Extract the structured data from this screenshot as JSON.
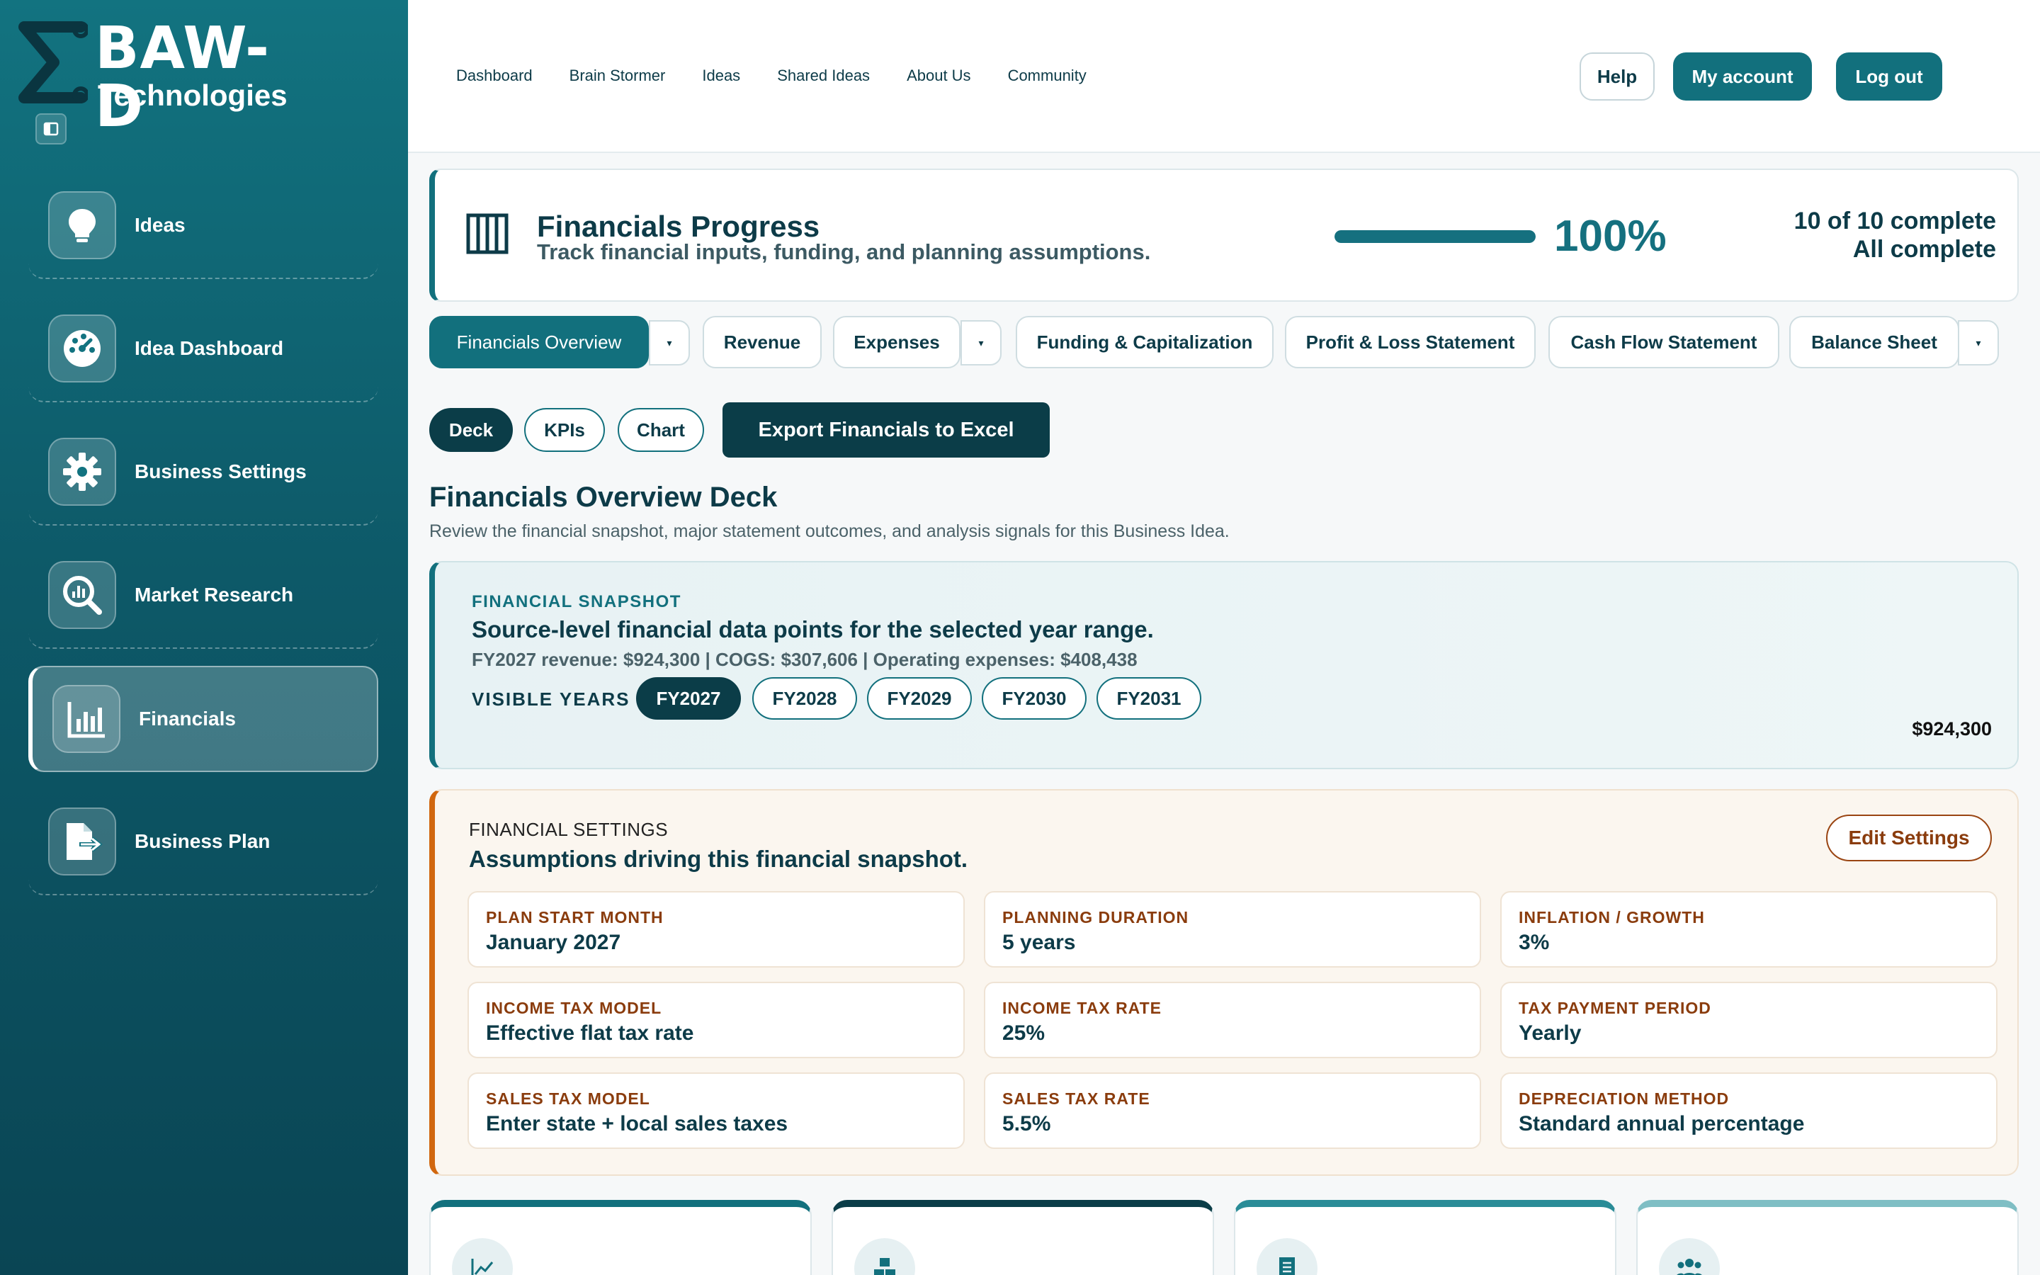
{
  "brand": {
    "name": "BAW-D",
    "sub": "Technologies"
  },
  "sidebar": {
    "items": [
      {
        "label": "Ideas",
        "icon": "lightbulb-icon"
      },
      {
        "label": "Idea Dashboard",
        "icon": "gauge-icon"
      },
      {
        "label": "Business Settings",
        "icon": "gear-icon"
      },
      {
        "label": "Market Research",
        "icon": "magnifier-chart-icon"
      },
      {
        "label": "Financials",
        "icon": "bar-chart-icon",
        "active": true
      },
      {
        "label": "Business Plan",
        "icon": "document-export-icon"
      }
    ]
  },
  "topnav": {
    "links": [
      "Dashboard",
      "Brain Stormer",
      "Ideas",
      "Shared Ideas",
      "About Us",
      "Community"
    ],
    "help": "Help",
    "account": "My account",
    "logout": "Log out"
  },
  "progress": {
    "title": "Financials Progress",
    "subtitle": "Track financial inputs, funding, and planning assumptions.",
    "percent": 100,
    "percent_label": "100%",
    "count": "10 of 10 complete",
    "status": "All complete"
  },
  "tabs": [
    "Financials Overview",
    "Revenue",
    "Expenses",
    "Funding & Capitalization",
    "Profit & Loss Statement",
    "Cash Flow Statement",
    "Balance Sheet"
  ],
  "subtabs": {
    "deck": "Deck",
    "kpis": "KPIs",
    "chart": "Chart",
    "export": "Export Financials to Excel"
  },
  "deck": {
    "title": "Financials Overview Deck",
    "subtitle": "Review the financial snapshot, major statement outcomes, and analysis signals for this Business Idea."
  },
  "snapshot": {
    "kicker": "FINANCIAL SNAPSHOT",
    "title": "Source-level financial data points for the selected year range.",
    "line": "FY2027 revenue: $924,300 | COGS: $307,606 | Operating expenses: $408,438",
    "visible_years_label": "VISIBLE YEARS",
    "years": [
      "FY2027",
      "FY2028",
      "FY2029",
      "FY2030",
      "FY2031"
    ],
    "selected_year": "FY2027",
    "value": "$924,300"
  },
  "settings": {
    "kicker": "FINANCIAL SETTINGS",
    "title": "Assumptions driving this financial snapshot.",
    "edit": "Edit Settings",
    "items": [
      {
        "label": "PLAN START MONTH",
        "value": "January 2027"
      },
      {
        "label": "PLANNING DURATION",
        "value": "5 years"
      },
      {
        "label": "INFLATION / GROWTH",
        "value": "3%"
      },
      {
        "label": "INCOME TAX MODEL",
        "value": "Effective flat tax rate"
      },
      {
        "label": "INCOME TAX RATE",
        "value": "25%"
      },
      {
        "label": "TAX PAYMENT PERIOD",
        "value": "Yearly"
      },
      {
        "label": "SALES TAX MODEL",
        "value": "Enter state + local sales taxes"
      },
      {
        "label": "SALES TAX RATE",
        "value": "5.5%"
      },
      {
        "label": "DEPRECIATION METHOD",
        "value": "Standard annual percentage"
      }
    ]
  },
  "kpi_cards": [
    {
      "icon": "trend-line-icon"
    },
    {
      "icon": "boxes-icon"
    },
    {
      "icon": "receipt-icon"
    },
    {
      "icon": "people-icon"
    }
  ],
  "colors": {
    "primary": "#12707d",
    "dark": "#0b3d48",
    "accent": "#d1670f"
  }
}
